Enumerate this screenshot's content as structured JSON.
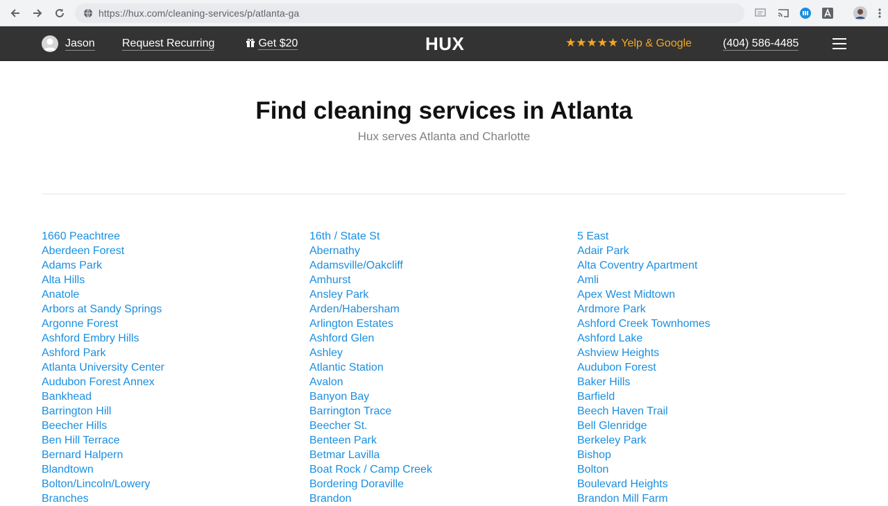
{
  "browser": {
    "url": "https://hux.com/cleaning-services/p/atlanta-ga"
  },
  "header": {
    "user_name": "Jason",
    "request_recurring": "Request Recurring",
    "get_reward": "Get $20",
    "logo": "HUX",
    "rating_stars": "★★★★★",
    "rating_text": "Yelp & Google",
    "phone": "(404) 586-4485"
  },
  "main": {
    "title": "Find cleaning services in Atlanta",
    "subtitle": "Hux serves Atlanta and Charlotte"
  },
  "neighborhoods": {
    "col1": [
      "1660 Peachtree",
      "Aberdeen Forest",
      "Adams Park",
      "Alta Hills",
      "Anatole",
      "Arbors at Sandy Springs",
      "Argonne Forest",
      "Ashford Embry Hills",
      "Ashford Park",
      "Atlanta University Center",
      "Audubon Forest Annex",
      "Bankhead",
      "Barrington Hill",
      "Beecher Hills",
      "Ben Hill Terrace",
      "Bernard Halpern",
      "Blandtown",
      "Bolton/Lincoln/Lowery",
      "Branches"
    ],
    "col2": [
      "16th / State St",
      "Abernathy",
      "Adamsville/Oakcliff",
      "Amhurst",
      "Ansley Park",
      "Arden/Habersham",
      "Arlington Estates",
      "Ashford Glen",
      "Ashley",
      "Atlantic Station",
      "Avalon",
      "Banyon Bay",
      "Barrington Trace",
      "Beecher St.",
      "Benteen Park",
      "Betmar Lavilla",
      "Boat Rock / Camp Creek",
      "Bordering Doraville",
      "Brandon"
    ],
    "col3": [
      "5 East",
      "Adair Park",
      "Alta Coventry Apartment",
      "Amli",
      "Apex West Midtown",
      "Ardmore Park",
      "Ashford Creek Townhomes",
      "Ashford Lake",
      "Ashview Heights",
      "Audubon Forest",
      "Baker Hills",
      "Barfield",
      "Beech Haven Trail",
      "Bell Glenridge",
      "Berkeley Park",
      "Bishop",
      "Bolton",
      "Boulevard Heights",
      "Brandon Mill Farm"
    ]
  },
  "colors": {
    "header_bg": "#333333",
    "link": "#1a8fe0",
    "rating": "#f5a623"
  }
}
